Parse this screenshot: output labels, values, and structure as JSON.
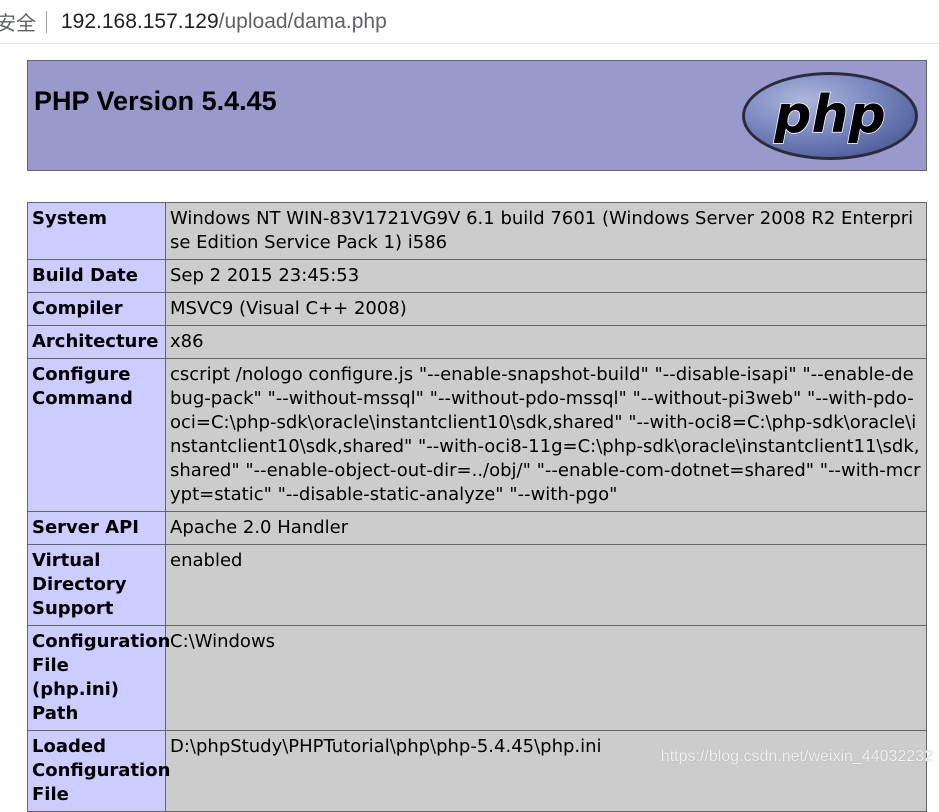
{
  "browser": {
    "security_label": "安全",
    "url_host": "192.168.157.129",
    "url_path": "/upload/dama.php"
  },
  "header": {
    "title": "PHP Version 5.4.45",
    "logo_text": "php"
  },
  "rows": [
    {
      "key": "System",
      "value": "Windows NT WIN-83V1721VG9V 6.1 build 7601 (Windows Server 2008 R2 Enterprise Edition Service Pack 1) i586"
    },
    {
      "key": "Build Date",
      "value": "Sep 2 2015 23:45:53"
    },
    {
      "key": "Compiler",
      "value": "MSVC9 (Visual C++ 2008)"
    },
    {
      "key": "Architecture",
      "value": "x86"
    },
    {
      "key": "Configure Command",
      "value": "cscript /nologo configure.js \"--enable-snapshot-build\" \"--disable-isapi\" \"--enable-debug-pack\" \"--without-mssql\" \"--without-pdo-mssql\" \"--without-pi3web\" \"--with-pdo-oci=C:\\php-sdk\\oracle\\instantclient10\\sdk,shared\" \"--with-oci8=C:\\php-sdk\\oracle\\instantclient10\\sdk,shared\" \"--with-oci8-11g=C:\\php-sdk\\oracle\\instantclient11\\sdk,shared\" \"--enable-object-out-dir=../obj/\" \"--enable-com-dotnet=shared\" \"--with-mcrypt=static\" \"--disable-static-analyze\" \"--with-pgo\""
    },
    {
      "key": "Server API",
      "value": "Apache 2.0 Handler"
    },
    {
      "key": "Virtual Directory Support",
      "value": "enabled"
    },
    {
      "key": "Configuration File (php.ini) Path",
      "value": "C:\\Windows"
    },
    {
      "key": "Loaded Configuration File",
      "value": "D:\\phpStudy\\PHPTutorial\\php\\php-5.4.45\\php.ini"
    }
  ],
  "watermark": "https://blog.csdn.net/weixin_44032232",
  "colors": {
    "header_bg": "#9999cc",
    "key_bg": "#ccccff",
    "value_bg": "#cccccc",
    "border": "#666666",
    "logo_fill": "#6c7eb7"
  }
}
